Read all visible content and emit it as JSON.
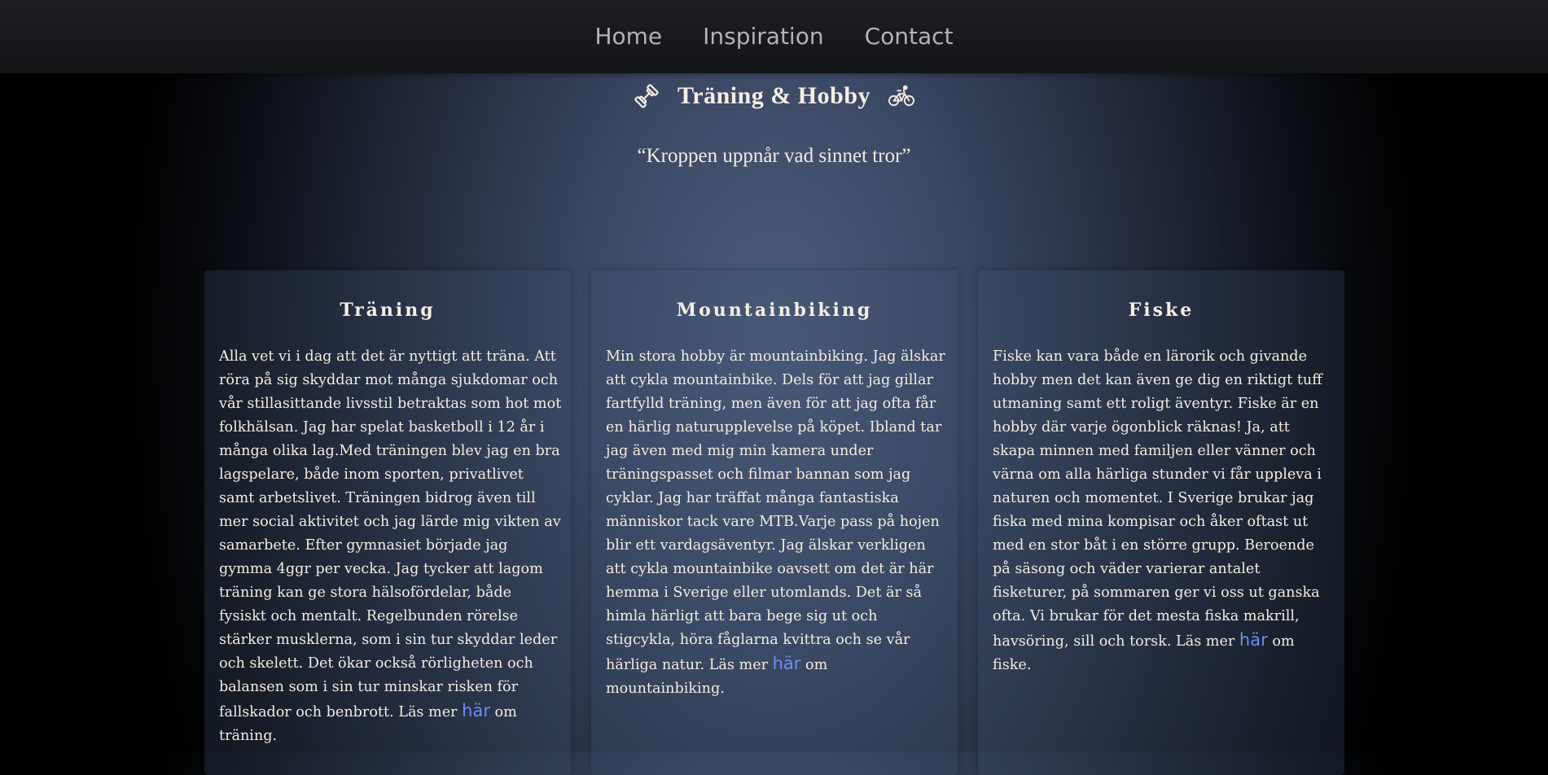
{
  "nav": {
    "items": [
      "Home",
      "Inspiration",
      "Contact"
    ]
  },
  "hero": {
    "title": "Träning & Hobby",
    "left_icon": "dumbbell-icon",
    "right_icon": "bicycle-icon",
    "quote": "“Kroppen uppnår vad sinnet tror”"
  },
  "cards": [
    {
      "title": "Träning",
      "text": "Alla vet vi i dag att det är nyttigt att träna. Att röra på sig skyddar mot många sjukdomar och vår stillasittande livsstil betraktas som hot mot folkhälsan. Jag har spelat basketboll i 12 år i många olika lag.Med träningen blev jag en bra lagspelare, både inom sporten, privatlivet samt arbetslivet. Träningen bidrog även till mer social aktivitet och jag lärde mig vikten av samarbete. Efter gymnasiet började jag gymma 4ggr per vecka. Jag tycker att lagom träning kan ge stora hälsofördelar, både fysiskt och mentalt. Regelbunden rörelse stärker musklerna, som i sin tur skyddar leder och skelett. Det ökar också rörligheten och balansen som i sin tur minskar risken för fallskador och benbrott. Läs mer ",
      "link": "här",
      "after": " om träning."
    },
    {
      "title": "Mountainbiking",
      "text": "Min stora hobby är mountainbiking. Jag älskar att cykla mountainbike. Dels för att jag gillar fartfylld träning, men även för att jag ofta får en härlig naturupplevelse på köpet. Ibland tar jag även med mig min kamera under träningspasset och filmar bannan som jag cyklar. Jag har träffat många fantastiska människor tack vare MTB.Varje pass på hojen blir ett vardagsäventyr. Jag älskar verkligen att cykla mountainbike oavsett om det är här hemma i Sverige eller utomlands. Det är så himla härligt att bara bege sig ut och stigcykla, höra fåglarna kvittra och se vår härliga natur. Läs mer ",
      "link": "här",
      "after": " om mountainbiking."
    },
    {
      "title": "Fiske",
      "text": "Fiske kan vara både en lärorik och givande hobby men det kan även ge dig en riktigt tuff utmaning samt ett roligt äventyr. Fiske är en hobby där varje ögonblick räknas! Ja, att skapa minnen med familjen eller vänner och värna om alla härliga stunder vi får uppleva i naturen och momentet. I Sverige brukar jag fiska med mina kompisar och åker oftast ut med en stor båt i en större grupp. Beroende på säsong och väder varierar antalet fisketurer, på sommaren ger vi oss ut ganska ofta. Vi brukar för det mesta fiska makrill, havsöring, sill och torsk. Läs mer ",
      "link": "här",
      "after": " om fiske."
    }
  ],
  "colors": {
    "nav_bg": "#1c1e22",
    "nav_text": "#b3b3b3",
    "text": "#f4ece0",
    "link": "#6a8ff0",
    "background_center": "#4c5d7c"
  }
}
